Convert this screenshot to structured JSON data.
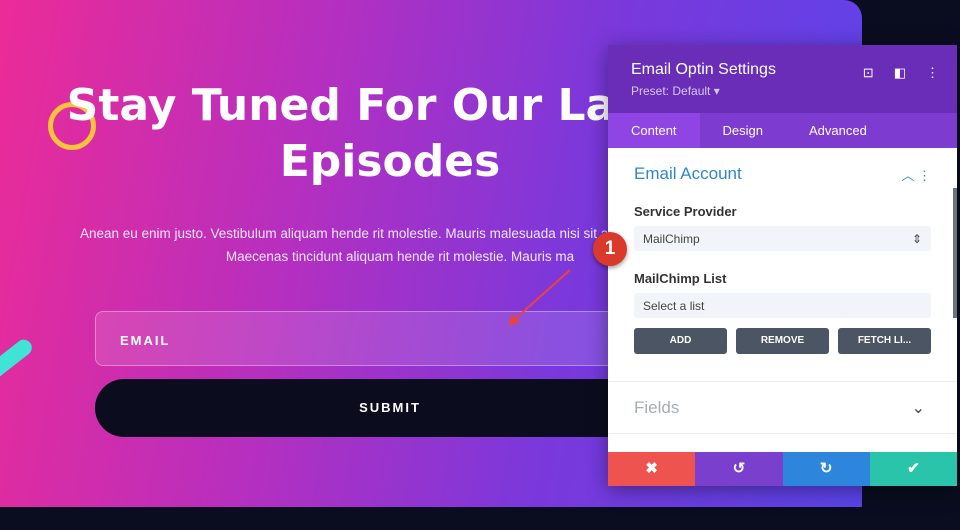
{
  "hero": {
    "title": "Stay Tuned For Our Latest Episodes",
    "body": "Anean eu enim justo. Vestibulum aliquam hende rit molestie. Mauris malesuada nisi sit accumsan tincidunt. Maecenas tincidunt aliquam hende rit molestie. Mauris ma",
    "email_placeholder": "EMAIL",
    "submit_label": "SUBMIT"
  },
  "annotation": {
    "badge": "1"
  },
  "panel": {
    "title": "Email Optin Settings",
    "preset": "Preset: Default ▾",
    "tabs": [
      {
        "label": "Content"
      },
      {
        "label": "Design"
      },
      {
        "label": "Advanced"
      }
    ],
    "section": {
      "title": "Email Account",
      "service_label": "Service Provider",
      "service_value": "MailChimp",
      "list_label": "MailChimp List",
      "list_placeholder": "Select a list",
      "buttons": [
        {
          "label": "ADD"
        },
        {
          "label": "REMOVE"
        },
        {
          "label": "FETCH LI..."
        }
      ]
    },
    "fields_title": "Fields"
  },
  "colors": {
    "accent": "#6a2db8",
    "cancel": "#ef5350",
    "undo": "#7b3fce",
    "redo": "#2d86db",
    "save": "#29c4a9"
  }
}
